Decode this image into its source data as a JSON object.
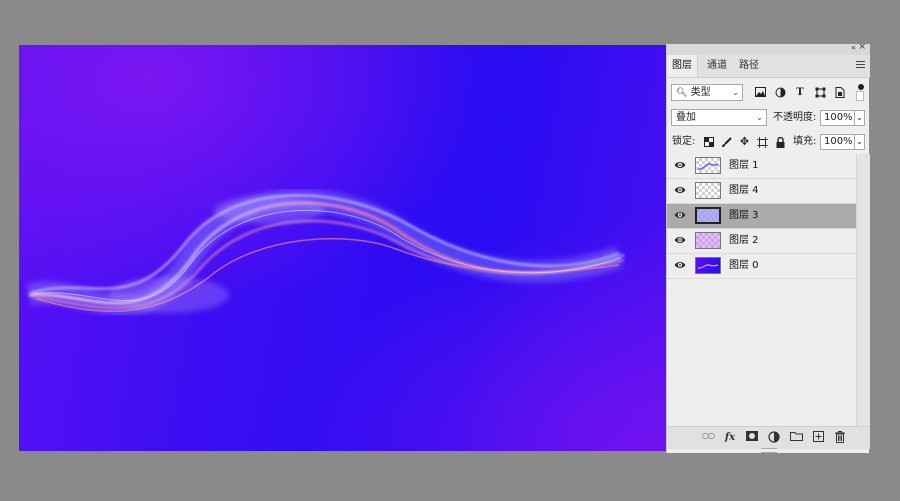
{
  "panel": {
    "tabs": [
      {
        "label": "图层",
        "active": true
      },
      {
        "label": "通道",
        "active": false
      },
      {
        "label": "路径",
        "active": false
      }
    ],
    "filter": {
      "value": "类型"
    },
    "blend_mode": {
      "value": "叠加"
    },
    "opacity": {
      "label": "不透明度:",
      "value": "100%"
    },
    "lock": {
      "label": "锁定:"
    },
    "fill": {
      "label": "填充:",
      "value": "100%"
    },
    "layers": [
      {
        "name": "图层 1",
        "selected": false
      },
      {
        "name": "图层 4",
        "selected": false
      },
      {
        "name": "图层 3",
        "selected": true
      },
      {
        "name": "图层 2",
        "selected": false
      },
      {
        "name": "图层 0",
        "selected": false
      }
    ]
  },
  "icons": {
    "collapse": "«",
    "close": "×",
    "fx": "fx"
  },
  "colors": {
    "canvas_purple": "#7a16f2",
    "canvas_blue": "#2a0cf2",
    "selected_layer": "#ababab",
    "workspace": "#8a8a8a"
  }
}
